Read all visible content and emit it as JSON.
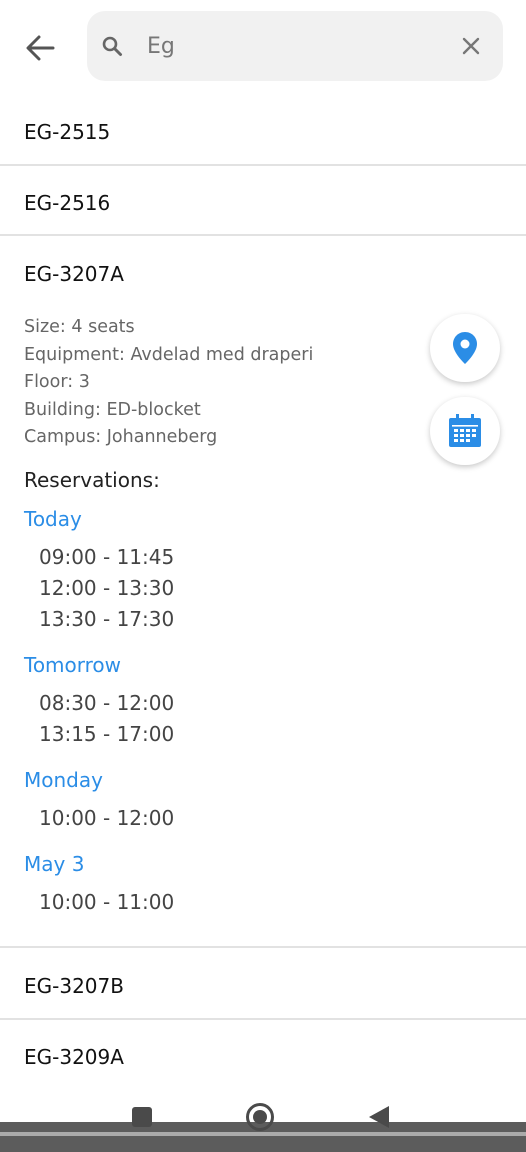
{
  "search": {
    "value": "Eg"
  },
  "rooms_top": [
    "EG-2515",
    "EG-2516"
  ],
  "expanded": {
    "name": "EG-3207A",
    "details": [
      "Size: 4 seats",
      "Equipment: Avdelad med draperi",
      "Floor: 3",
      "Building: ED-blocket",
      "Campus: Johanneberg"
    ],
    "reservations_label": "Reservations:",
    "days": [
      {
        "label": "Today",
        "slots": [
          "09:00 - 11:45",
          "12:00 - 13:30",
          "13:30 - 17:30"
        ]
      },
      {
        "label": "Tomorrow",
        "slots": [
          "08:30 - 12:00",
          "13:15 - 17:00"
        ]
      },
      {
        "label": "Monday",
        "slots": [
          "10:00 - 12:00"
        ]
      },
      {
        "label": "May 3",
        "slots": [
          "10:00 - 11:00"
        ]
      }
    ]
  },
  "rooms_bottom": [
    "EG-3207B",
    "EG-3209A"
  ],
  "colors": {
    "accent": "#2b8de6",
    "divider": "#e2e2e2",
    "nav_strip": "#5c5c5c"
  },
  "icons": [
    "back-arrow-icon",
    "search-icon",
    "close-icon",
    "location-pin-icon",
    "calendar-icon",
    "recent-apps-icon",
    "home-icon",
    "back-triangle-icon"
  ]
}
